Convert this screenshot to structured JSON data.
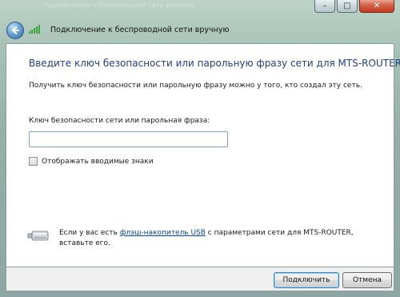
{
  "window": {
    "ghost_title": "Подключение к беспроводной сети вручную",
    "controls": {
      "minimize": "–",
      "maximize": "□",
      "close": "✕"
    }
  },
  "header": {
    "back_icon": "back-arrow-icon",
    "network_icon": "wireless-signal-icon",
    "title": "Подключение к беспроводной сети вручную"
  },
  "main": {
    "heading": "Введите ключ безопасности или парольную фразу сети для MTS-ROUTER",
    "info": "Получить ключ безопасности или парольную фразу можно у того, кто создал эту сеть.",
    "key_label": "Ключ безопасности сети или парольная фраза:",
    "key_value": "",
    "show_chars_label": "Отображать вводимые знаки",
    "show_chars_checked": false,
    "usb": {
      "icon": "usb-drive-icon",
      "text_before": "Если у вас есть ",
      "link": "флэш-накопитель USB",
      "text_after": " с параметрами сети для MTS-ROUTER, вставьте его."
    }
  },
  "footer": {
    "connect_label": "Подключить",
    "cancel_label": "Отмена"
  },
  "colors": {
    "heading": "#1e3f8a",
    "link": "#0645ad",
    "frame": "#a7c0b5",
    "close_button": "#c23a22"
  }
}
